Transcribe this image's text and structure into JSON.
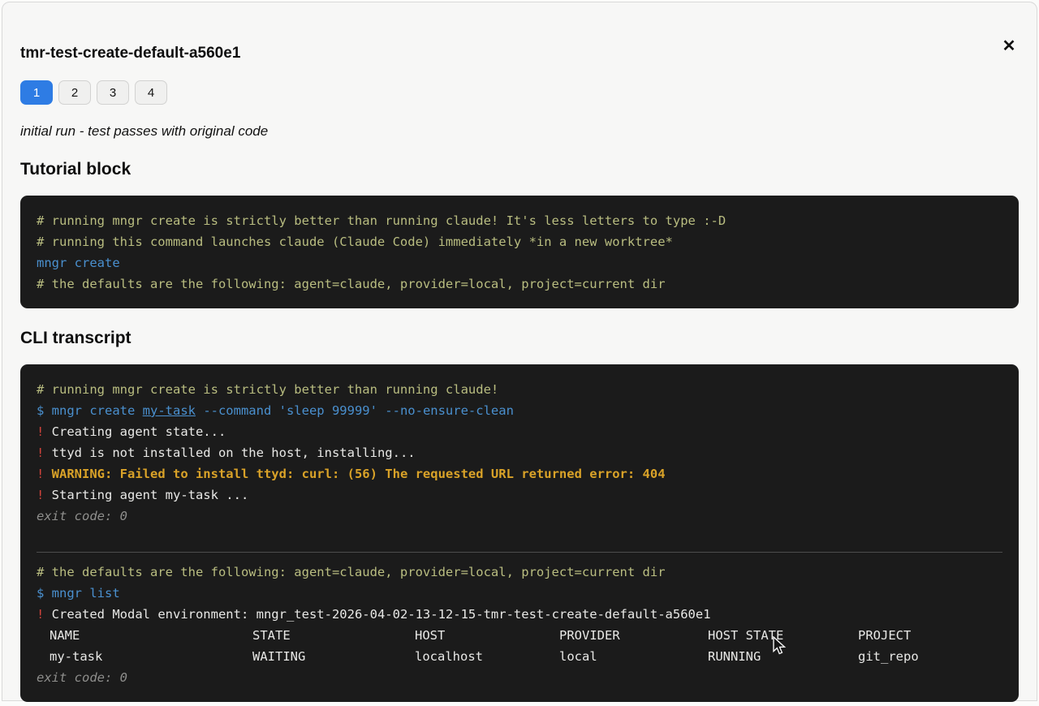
{
  "modal": {
    "title": "tmr-test-create-default-a560e1",
    "close_label": "✕"
  },
  "pagination": {
    "pages": [
      "1",
      "2",
      "3",
      "4"
    ],
    "active_page": "1"
  },
  "run_note": "initial run - test passes with original code",
  "colors": {
    "accent_blue": "#2e7ce4",
    "terminal_bg": "#1b1b1b",
    "comment": "#b9bd80",
    "command_blue": "#4a90cf",
    "bang_red": "#d0433b",
    "warning_orange": "#d9a228",
    "exit_gray": "#8e8e8c"
  },
  "tutorial": {
    "heading": "Tutorial block",
    "line_comment_1": "# running mngr create is strictly better than running claude! It's less letters to type :-D",
    "line_comment_2": "# running this command launches claude (Claude Code) immediately *in a new worktree*",
    "line_command": "mngr create",
    "line_comment_3": "# the defaults are the following: agent=claude, provider=local, project=current dir"
  },
  "cli": {
    "heading": "CLI transcript",
    "run1": {
      "comment": "# running mngr create is strictly better than running claude!",
      "cmd_part1": "$ mngr create ",
      "cmd_link": "my-task",
      "cmd_part2": " --command 'sleep 99999' --no-ensure-clean",
      "bang": "!",
      "line_creating": " Creating agent state...",
      "line_ttyd": " ttyd is not installed on the host, installing...",
      "line_warning": " WARNING: Failed to install ttyd: curl: (56) The requested URL returned error: 404",
      "line_starting": " Starting agent my-task ...",
      "exit_line": "exit code: 0"
    },
    "run2": {
      "comment": "# the defaults are the following: agent=claude, provider=local, project=current dir",
      "cmd": "$ mngr list",
      "bang": "!",
      "line_created": " Created Modal environment: mngr_test-2026-04-02-13-12-15-tmr-test-create-default-a560e1",
      "table": {
        "headers": [
          "NAME",
          "STATE",
          "HOST",
          "PROVIDER",
          "HOST STATE",
          "PROJECT"
        ],
        "row": [
          "my-task",
          "WAITING",
          "localhost",
          "local",
          "RUNNING",
          "git_repo"
        ]
      },
      "exit_line": "exit code: 0"
    }
  }
}
